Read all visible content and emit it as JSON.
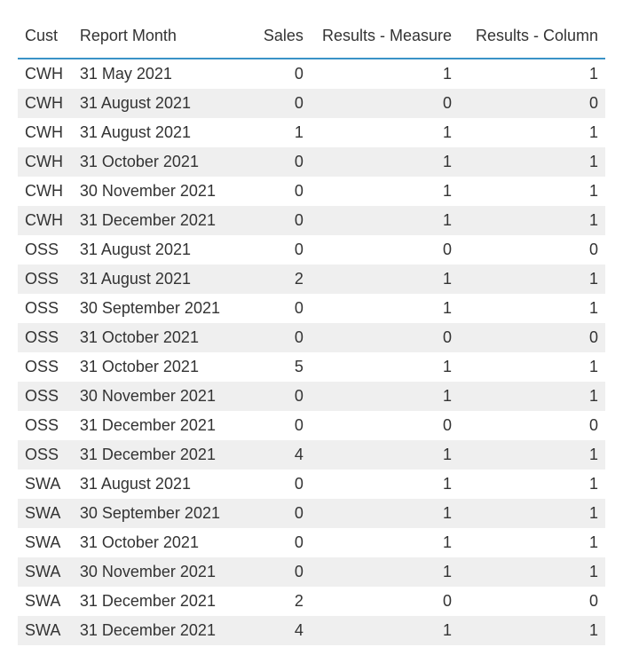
{
  "table": {
    "headers": {
      "cust": "Cust",
      "report_month": "Report Month",
      "sales": "Sales",
      "results_measure": "Results - Measure",
      "results_column": "Results - Column"
    },
    "rows": [
      {
        "cust": "CWH",
        "month": "31 May 2021",
        "sales": "0",
        "measure": "1",
        "column": "1"
      },
      {
        "cust": "CWH",
        "month": "31 August 2021",
        "sales": "0",
        "measure": "0",
        "column": "0"
      },
      {
        "cust": "CWH",
        "month": "31 August 2021",
        "sales": "1",
        "measure": "1",
        "column": "1"
      },
      {
        "cust": "CWH",
        "month": "31 October 2021",
        "sales": "0",
        "measure": "1",
        "column": "1"
      },
      {
        "cust": "CWH",
        "month": "30 November 2021",
        "sales": "0",
        "measure": "1",
        "column": "1"
      },
      {
        "cust": "CWH",
        "month": "31 December 2021",
        "sales": "0",
        "measure": "1",
        "column": "1"
      },
      {
        "cust": "OSS",
        "month": "31 August 2021",
        "sales": "0",
        "measure": "0",
        "column": "0"
      },
      {
        "cust": "OSS",
        "month": "31 August 2021",
        "sales": "2",
        "measure": "1",
        "column": "1"
      },
      {
        "cust": "OSS",
        "month": "30 September 2021",
        "sales": "0",
        "measure": "1",
        "column": "1"
      },
      {
        "cust": "OSS",
        "month": "31 October 2021",
        "sales": "0",
        "measure": "0",
        "column": "0"
      },
      {
        "cust": "OSS",
        "month": "31 October 2021",
        "sales": "5",
        "measure": "1",
        "column": "1"
      },
      {
        "cust": "OSS",
        "month": "30 November 2021",
        "sales": "0",
        "measure": "1",
        "column": "1"
      },
      {
        "cust": "OSS",
        "month": "31 December 2021",
        "sales": "0",
        "measure": "0",
        "column": "0"
      },
      {
        "cust": "OSS",
        "month": "31 December 2021",
        "sales": "4",
        "measure": "1",
        "column": "1"
      },
      {
        "cust": "SWA",
        "month": "31 August 2021",
        "sales": "0",
        "measure": "1",
        "column": "1"
      },
      {
        "cust": "SWA",
        "month": "30 September 2021",
        "sales": "0",
        "measure": "1",
        "column": "1"
      },
      {
        "cust": "SWA",
        "month": "31 October 2021",
        "sales": "0",
        "measure": "1",
        "column": "1"
      },
      {
        "cust": "SWA",
        "month": "30 November 2021",
        "sales": "0",
        "measure": "1",
        "column": "1"
      },
      {
        "cust": "SWA",
        "month": "31 December 2021",
        "sales": "2",
        "measure": "0",
        "column": "0"
      },
      {
        "cust": "SWA",
        "month": "31 December 2021",
        "sales": "4",
        "measure": "1",
        "column": "1"
      }
    ]
  },
  "chart_data": {
    "type": "table",
    "title": "",
    "columns": [
      "Cust",
      "Report Month",
      "Sales",
      "Results - Measure",
      "Results - Column"
    ],
    "rows": [
      [
        "CWH",
        "31 May 2021",
        0,
        1,
        1
      ],
      [
        "CWH",
        "31 August 2021",
        0,
        0,
        0
      ],
      [
        "CWH",
        "31 August 2021",
        1,
        1,
        1
      ],
      [
        "CWH",
        "31 October 2021",
        0,
        1,
        1
      ],
      [
        "CWH",
        "30 November 2021",
        0,
        1,
        1
      ],
      [
        "CWH",
        "31 December 2021",
        0,
        1,
        1
      ],
      [
        "OSS",
        "31 August 2021",
        0,
        0,
        0
      ],
      [
        "OSS",
        "31 August 2021",
        2,
        1,
        1
      ],
      [
        "OSS",
        "30 September 2021",
        0,
        1,
        1
      ],
      [
        "OSS",
        "31 October 2021",
        0,
        0,
        0
      ],
      [
        "OSS",
        "31 October 2021",
        5,
        1,
        1
      ],
      [
        "OSS",
        "30 November 2021",
        0,
        1,
        1
      ],
      [
        "OSS",
        "31 December 2021",
        0,
        0,
        0
      ],
      [
        "OSS",
        "31 December 2021",
        4,
        1,
        1
      ],
      [
        "SWA",
        "31 August 2021",
        0,
        1,
        1
      ],
      [
        "SWA",
        "30 September 2021",
        0,
        1,
        1
      ],
      [
        "SWA",
        "31 October 2021",
        0,
        1,
        1
      ],
      [
        "SWA",
        "30 November 2021",
        0,
        1,
        1
      ],
      [
        "SWA",
        "31 December 2021",
        2,
        0,
        0
      ],
      [
        "SWA",
        "31 December 2021",
        4,
        1,
        1
      ]
    ]
  }
}
